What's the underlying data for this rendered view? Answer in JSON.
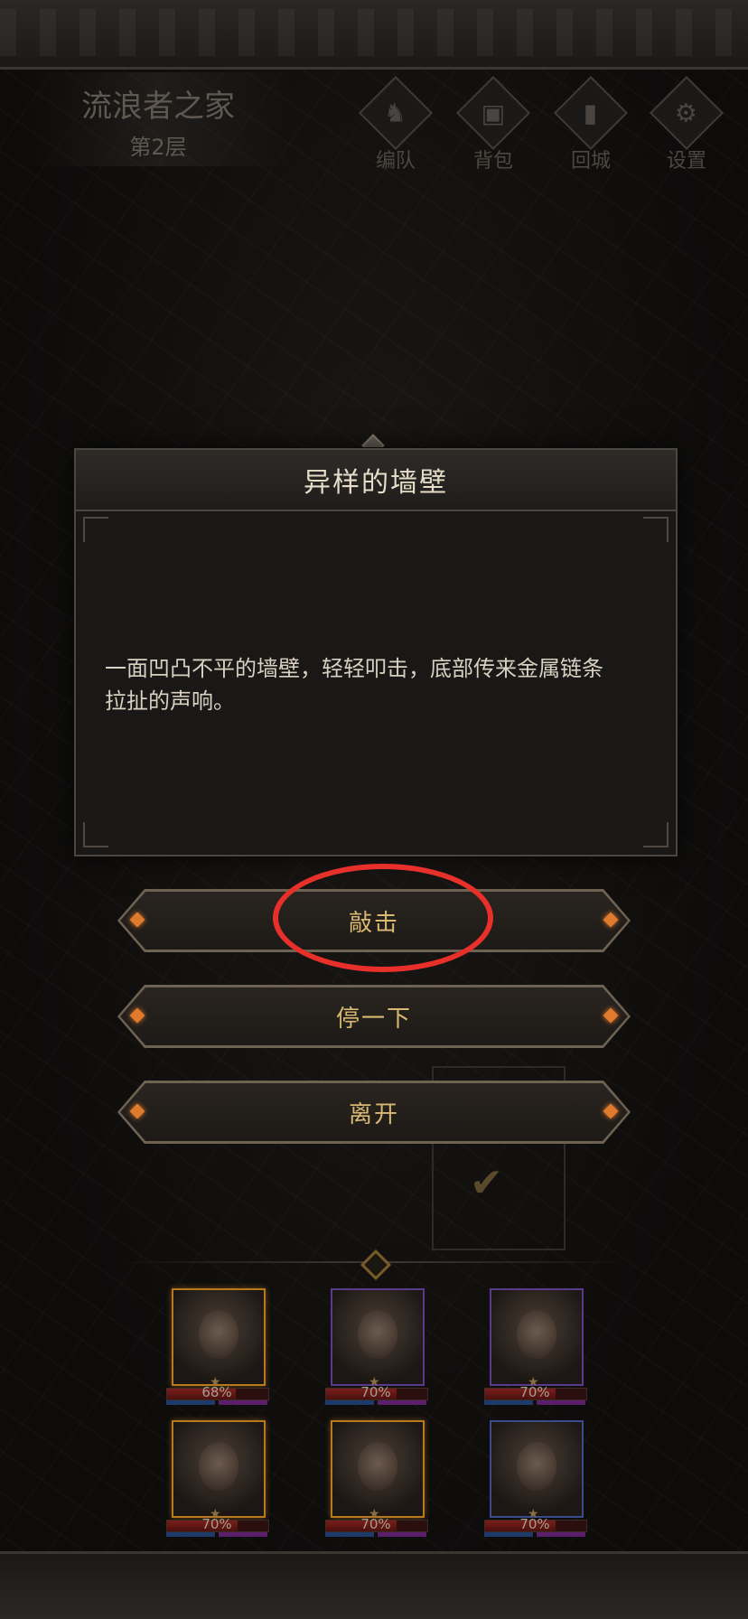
{
  "header": {
    "floor_name": "流浪者之家",
    "floor_level": "第2层",
    "nav": [
      {
        "label": "编队",
        "icon": "helmet-icon"
      },
      {
        "label": "背包",
        "icon": "backpack-icon"
      },
      {
        "label": "回城",
        "icon": "door-icon"
      },
      {
        "label": "设置",
        "icon": "gear-icon"
      }
    ]
  },
  "dialog": {
    "title": "异样的墙壁",
    "body_line1": "一面凹凸不平的墙壁，轻轻叩击，底部传来金属链条",
    "body_line2": "拉扯的声响。"
  },
  "choices": [
    {
      "label": "敲击"
    },
    {
      "label": "停一下"
    },
    {
      "label": "离开"
    }
  ],
  "annotation": {
    "color": "#e8302a",
    "target": "敲击"
  },
  "team": [
    {
      "hp": "68%",
      "hp_value": 0.68,
      "frame": "gold"
    },
    {
      "hp": "70%",
      "hp_value": 0.7,
      "frame": "purple"
    },
    {
      "hp": "70%",
      "hp_value": 0.7,
      "frame": "purple"
    },
    {
      "hp": "70%",
      "hp_value": 0.7,
      "frame": "gold"
    },
    {
      "hp": "70%",
      "hp_value": 0.7,
      "frame": "gold"
    },
    {
      "hp": "70%",
      "hp_value": 0.7,
      "frame": "blue"
    }
  ],
  "colors": {
    "choice_text": "#d9b872",
    "gem_orange": "#e07a2c",
    "hp_red": "#7a1e1a"
  }
}
